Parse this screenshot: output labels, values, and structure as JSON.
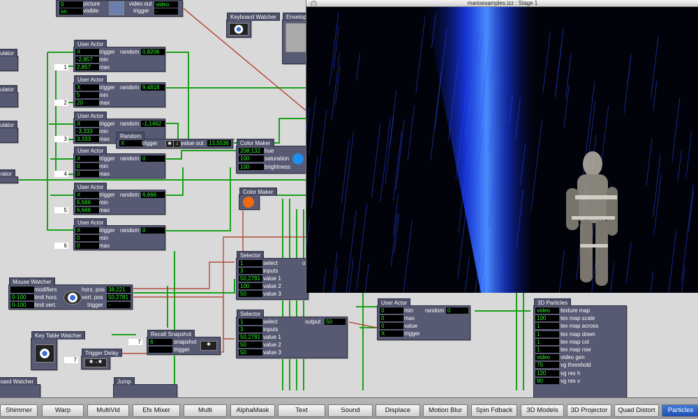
{
  "stage": {
    "title": "marioexamples.izz : Stage 1"
  },
  "top": {
    "picture_vals": [
      "0",
      "on"
    ],
    "picture_labels": [
      "picture",
      "visible"
    ],
    "video_out_label": "video out",
    "video_out_value": "video",
    "trigger_label": "trigger",
    "trigger_value": "-"
  },
  "calc_labels": [
    "culator",
    "culator",
    "culator",
    "erator"
  ],
  "keyboard_watcher": "Keyboard Watcher",
  "envelope_title": "Envelop",
  "user_actors": [
    {
      "title": "User Actor",
      "values": [
        "X",
        "-2,857",
        "2,857"
      ],
      "out": "0,8206",
      "port": "1",
      "labels": [
        "trigger",
        "min",
        "max"
      ],
      "out_label": "random"
    },
    {
      "title": "User Actor",
      "values": [
        "X",
        "5",
        "20"
      ],
      "out": "9,4818",
      "port": "2",
      "labels": [
        "trigger",
        "min",
        "max"
      ],
      "out_label": "random"
    },
    {
      "title": "User Actor",
      "values": [
        "X",
        "-3,333",
        "3,333"
      ],
      "out": "-1,1462",
      "port": "3",
      "labels": [
        "trigger",
        "min",
        "max"
      ],
      "out_label": "random"
    },
    {
      "title": "User Actor",
      "values": [
        "X",
        "0",
        "0"
      ],
      "out": "0",
      "port": "4",
      "labels": [
        "trigger",
        "min",
        "max"
      ],
      "out_label": "random"
    },
    {
      "title": "User Actor",
      "values": [
        "X",
        "6,666",
        "6,666"
      ],
      "out": "6,666",
      "port": "5",
      "labels": [
        "trigger",
        "min",
        "max"
      ],
      "out_label": "random"
    },
    {
      "title": "User Actor",
      "values": [
        "X",
        "0",
        "0"
      ],
      "out": "0",
      "port": "6",
      "labels": [
        "trigger",
        "min",
        "max"
      ],
      "out_label": "random"
    }
  ],
  "random": {
    "title": "Random",
    "in": "X",
    "trigger": "trigger",
    "out_label": "value out",
    "out": "13,5536"
  },
  "color_maker_1": {
    "title": "Color Maker",
    "labels": [
      "hue",
      "saturation",
      "brightness"
    ],
    "values": [
      "208,132",
      "100",
      "100"
    ],
    "color": "#1f8ef0"
  },
  "color_maker_2": {
    "title": "Color Maker",
    "color": "#f06a12"
  },
  "mouse_watcher": {
    "title": "Mouse Watcher",
    "labels": [
      "modifiers",
      "limit horz.",
      "limit vert."
    ],
    "values": [
      "",
      "0-100",
      "0-100"
    ],
    "out_labels": [
      "horz. pos",
      "vert. pos",
      "trigger"
    ],
    "outs": [
      "38,221",
      "50,2781",
      "-"
    ]
  },
  "selector_1": {
    "title": "Selector",
    "labels": [
      "select",
      "inputs",
      "value 1",
      "value 2",
      "value 3"
    ],
    "values": [
      "1",
      "3",
      "50,2781",
      "100",
      "50"
    ],
    "out": "out"
  },
  "selector_2": {
    "title": "Selector",
    "labels": [
      "select",
      "inputs",
      "value 1",
      "value 2",
      "value 3"
    ],
    "values": [
      "1",
      "3",
      "50,2781",
      "50",
      "50"
    ],
    "out_label": "output",
    "out": "50"
  },
  "key_table_watcher": {
    "title": "Key Table Watcher"
  },
  "recall_snapshot": {
    "title": "Recall Snapshot",
    "port": "7",
    "value": "6",
    "labels": [
      "snapshot",
      "trigger"
    ]
  },
  "trigger_delay": {
    "title": "Trigger Delay",
    "port": "7"
  },
  "keyboard_watcher_2": "board Watcher",
  "jump": "Jump",
  "user_actor_bottom": {
    "title": "User Actor",
    "labels": [
      "min",
      "max",
      "value",
      "trigger"
    ],
    "values": [
      "0",
      "0",
      "0",
      "X"
    ],
    "out_label": "random",
    "out": "0"
  },
  "particles_3d": {
    "title": "3D Particles",
    "labels": [
      "texture map",
      "tex map scale",
      "tex map across",
      "tex map down",
      "tex map col",
      "tex map row",
      "video gen",
      "vg threshold",
      "vg res h",
      "vg res v"
    ],
    "values": [
      "video",
      "100",
      "1",
      "1",
      "1",
      "1",
      "video",
      "75",
      "120",
      "90"
    ]
  },
  "tabs": [
    "Shimmer",
    "Warp",
    "MultiVid",
    "Efx Mixer",
    "Multi",
    "AlphaMask",
    "Text",
    "Sound",
    "Displace",
    "Motion Blur",
    "Spin Fdback",
    "3D Models",
    "3D Projector",
    "Quad Distort",
    "Particles"
  ],
  "active_tab": "Particles"
}
